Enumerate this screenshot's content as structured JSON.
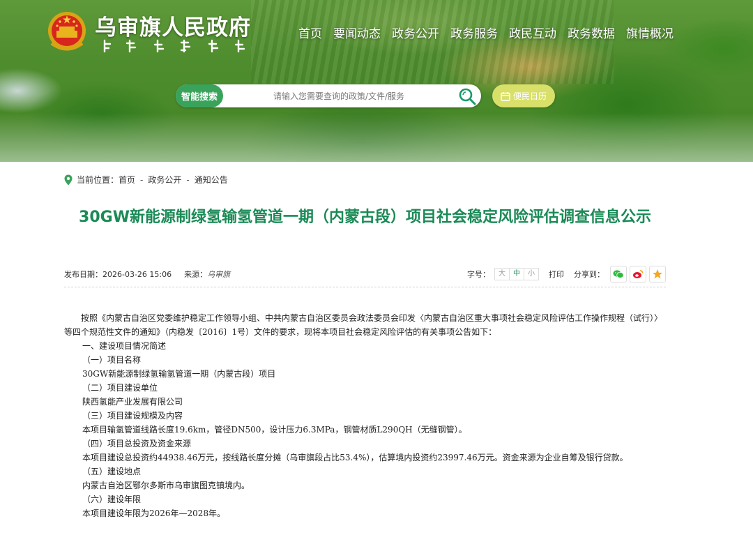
{
  "site": {
    "title": "乌审旗人民政府"
  },
  "nav": [
    "首页",
    "要闻动态",
    "政务公开",
    "政务服务",
    "政民互动",
    "政务数据",
    "旗情概况"
  ],
  "search": {
    "tag": "智能搜索",
    "placeholder": "请输入您需要查询的政策/文件/服务"
  },
  "calendar_label": "便民日历",
  "breadcrumb": {
    "label": "当前位置：",
    "items": [
      "首页",
      "政务公开",
      "通知公告"
    ]
  },
  "article": {
    "title": "30GW新能源制绿氢输氢管道一期（内蒙古段）项目社会稳定风险评估调查信息公示",
    "publish_label": "发布日期：",
    "publish_date": "2026-03-26 15:06",
    "source_label": "来源：",
    "source": "乌审旗",
    "font_label": "字号：",
    "font_sizes": [
      "大",
      "中",
      "小"
    ],
    "print_label": "打印",
    "share_label": "分享到：",
    "paragraphs": [
      "按照《内蒙古自治区党委维护稳定工作领导小组、中共内蒙古自治区委员会政法委员会印发〈内蒙古自治区重大事项社会稳定风险评估工作操作规程（试行）〉等四个规范性文件的通知》（内稳发〔2016〕1号）文件的要求，现将本项目社会稳定风险评估的有关事项公告如下：",
      "一、建设项目情况简述",
      "（一）项目名称",
      "30GW新能源制绿氢输氢管道一期（内蒙古段）项目",
      "（二）项目建设单位",
      "陕西氢能产业发展有限公司",
      "（三）项目建设规模及内容",
      "本项目输氢管道线路长度19.6km，管径DN500，设计压力6.3MPa，钢管材质L290QH（无缝钢管）。",
      "（四）项目总投资及资金来源",
      "本项目建设总投资约44938.46万元，按线路长度分摊（乌审旗段占比53.4%），估算境内投资约23997.46万元。资金来源为企业自筹及银行贷款。",
      "（五）建设地点",
      "内蒙古自治区鄂尔多斯市乌审旗图克镇境内。",
      "（六）建设年限",
      "本项目建设年限为2026年—2028年。"
    ]
  },
  "colors": {
    "accent": "#1a8a56",
    "search_tag": "#3aa35b",
    "calendar": "#d9e06a"
  }
}
